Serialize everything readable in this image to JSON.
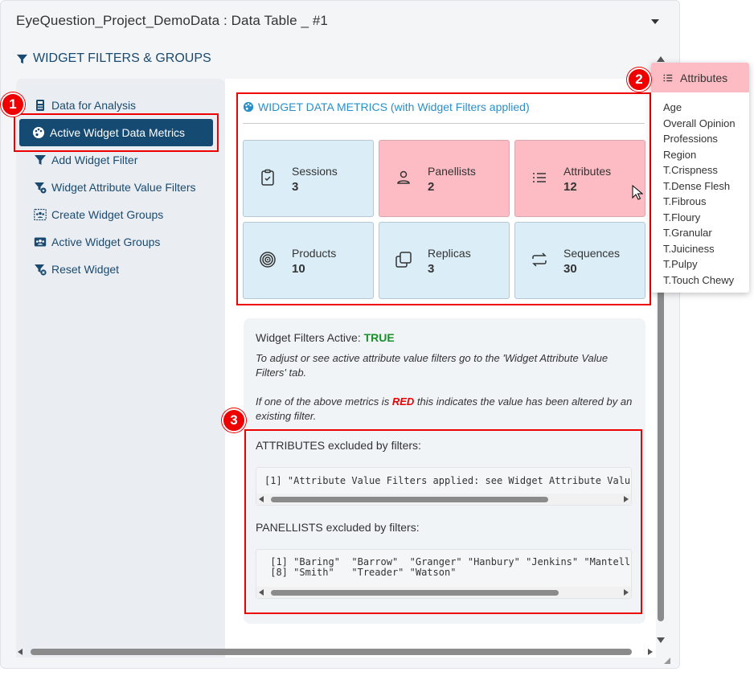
{
  "window": {
    "title": "EyeQuestion_Project_DemoData : Data Table _ #1"
  },
  "section": {
    "title": "WIDGET FILTERS & GROUPS"
  },
  "sidebar": {
    "items": [
      {
        "label": "Data for Analysis",
        "icon": "calculator-icon"
      },
      {
        "label": "Active Widget Data Metrics",
        "icon": "palette-icon",
        "active": true
      },
      {
        "label": "Add Widget Filter",
        "icon": "filter-icon"
      },
      {
        "label": "Widget Attribute Value Filters",
        "icon": "filter-gear-icon"
      },
      {
        "label": "Create Widget Groups",
        "icon": "users-group-icon"
      },
      {
        "label": "Active Widget Groups",
        "icon": "id-card-icon"
      },
      {
        "label": "Reset Widget",
        "icon": "filter-reset-icon"
      }
    ]
  },
  "metrics": {
    "title": "WIDGET DATA METRICS (with Widget Filters applied)",
    "cards": [
      {
        "label": "Sessions",
        "value": "3",
        "icon": "clipboard-check-icon",
        "altered": false
      },
      {
        "label": "Panellists",
        "value": "2",
        "icon": "person-icon",
        "altered": true
      },
      {
        "label": "Attributes",
        "value": "12",
        "icon": "list-icon",
        "altered": true
      },
      {
        "label": "Products",
        "value": "10",
        "icon": "target-icon",
        "altered": false
      },
      {
        "label": "Replicas",
        "value": "3",
        "icon": "copy-icon",
        "altered": false
      },
      {
        "label": "Sequences",
        "value": "30",
        "icon": "repeat-icon",
        "altered": false
      }
    ]
  },
  "info": {
    "filters_active_label": "Widget Filters Active:",
    "filters_active_value": "TRUE",
    "note1": "To adjust or see active attribute value filters go to the 'Widget Attribute Value Filters' tab.",
    "note2_pre": "If one of the above metrics is",
    "note2_red": "RED",
    "note2_post": "this indicates the value has been altered by an existing filter.",
    "attributes_label": "ATTRIBUTES excluded by filters:",
    "attributes_code": "[1] \"Attribute Value Filters applied: see Widget Attribute Valu",
    "panellists_label": "PANELLISTS excluded by filters:",
    "panellists_code": " [1] \"Baring\"  \"Barrow\"  \"Granger\" \"Hanbury\" \"Jenkins\" \"Mantell\n [8] \"Smith\"   \"Treader\" \"Watson\""
  },
  "popup": {
    "title": "Attributes",
    "items": [
      "Age",
      "Overall Opinion",
      "Professions",
      "Region",
      "T.Crispness",
      "T.Dense Flesh",
      "T.Fibrous",
      "T.Floury",
      "T.Granular",
      "T.Juiciness",
      "T.Pulpy",
      "T.Touch Chewy"
    ]
  },
  "annotations": {
    "badges": [
      "1",
      "2",
      "3"
    ]
  },
  "colors": {
    "primary": "#154a72",
    "accent": "#2a8fc9",
    "card_normal": "#dbeef8",
    "card_altered": "#fdbcc4",
    "annotation_red": "#e00000",
    "true_green": "#1a8f2a"
  }
}
